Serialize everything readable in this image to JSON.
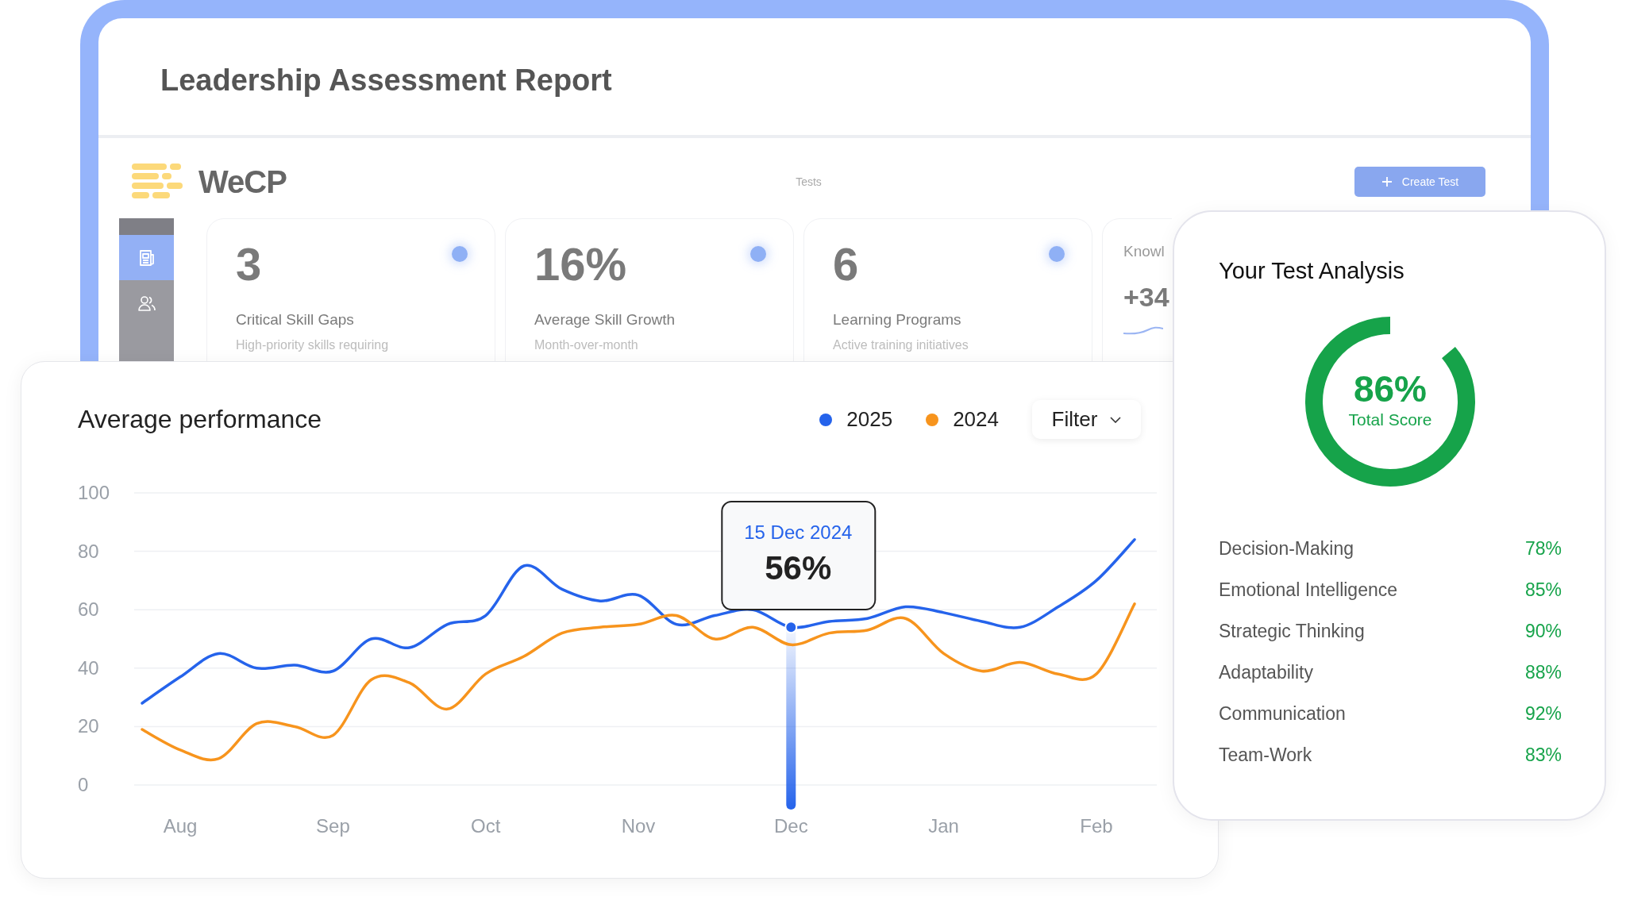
{
  "report": {
    "title": "Leadership Assessment Report",
    "app": {
      "logo": "WeCP",
      "nav_label": "Tests",
      "create_button": "Create Test",
      "sidebar": [
        {
          "kind": "documents",
          "selected": true
        },
        {
          "kind": "people",
          "selected": false
        }
      ],
      "stats": [
        {
          "kind": "metric",
          "value": "3",
          "label": "Critical Skill Gaps",
          "description": "High-priority skills requiring"
        },
        {
          "kind": "metric",
          "value": "16%",
          "label": "Average Skill Growth",
          "description": "Month-over-month"
        },
        {
          "kind": "metric",
          "value": "6",
          "label": "Learning Programs",
          "description": "Active training initiatives"
        },
        {
          "kind": "trend",
          "label": "Knowl",
          "value": "+34"
        }
      ]
    }
  },
  "performance": {
    "title": "Average performance",
    "filter": "Filter",
    "tooltip_date": "15 Dec 2024",
    "chart_data": {
      "type": "line",
      "categories": [
        null,
        "Aug",
        null,
        null,
        null,
        "Sep",
        null,
        null,
        null,
        "Oct",
        null,
        null,
        null,
        "Nov",
        null,
        null,
        null,
        "Dec",
        null,
        null,
        null,
        "Jan",
        null,
        null,
        null,
        "Feb",
        null
      ],
      "series": [
        {
          "name": "2025",
          "color": "#2563eb",
          "values": [
            28,
            37,
            45,
            40,
            41,
            39,
            50,
            47,
            55,
            58,
            75,
            67,
            63,
            65,
            55,
            58,
            60,
            54,
            56,
            57,
            61,
            59,
            56,
            54,
            61,
            70,
            84
          ]
        },
        {
          "name": "2024",
          "color": "#f7941d",
          "values": [
            19,
            12,
            9,
            21,
            20,
            17,
            36,
            35,
            26,
            38,
            44,
            52,
            54,
            55,
            58,
            50,
            54,
            48,
            52,
            53,
            57,
            45,
            39,
            42,
            38,
            38,
            62
          ]
        }
      ],
      "ylim": [
        0,
        100
      ],
      "grid": true,
      "yticks": [
        0,
        20,
        40,
        60,
        80,
        100
      ],
      "annotations": [
        {
          "x": "Dec",
          "y": 54,
          "text": "56%"
        }
      ]
    }
  },
  "analysis": {
    "title": "Your Test Analysis",
    "score": {
      "value": "86%",
      "label": "Total Score",
      "level": 0.86
    },
    "skills": [
      {
        "name": "Decision-Making",
        "score": "78%"
      },
      {
        "name": "Emotional Intelligence",
        "score": "85%"
      },
      {
        "name": "Strategic Thinking",
        "score": "90%"
      },
      {
        "name": "Adaptability",
        "score": "88%"
      },
      {
        "name": "Communication",
        "score": "92%"
      },
      {
        "name": "Team-Work",
        "score": "83%"
      }
    ]
  }
}
